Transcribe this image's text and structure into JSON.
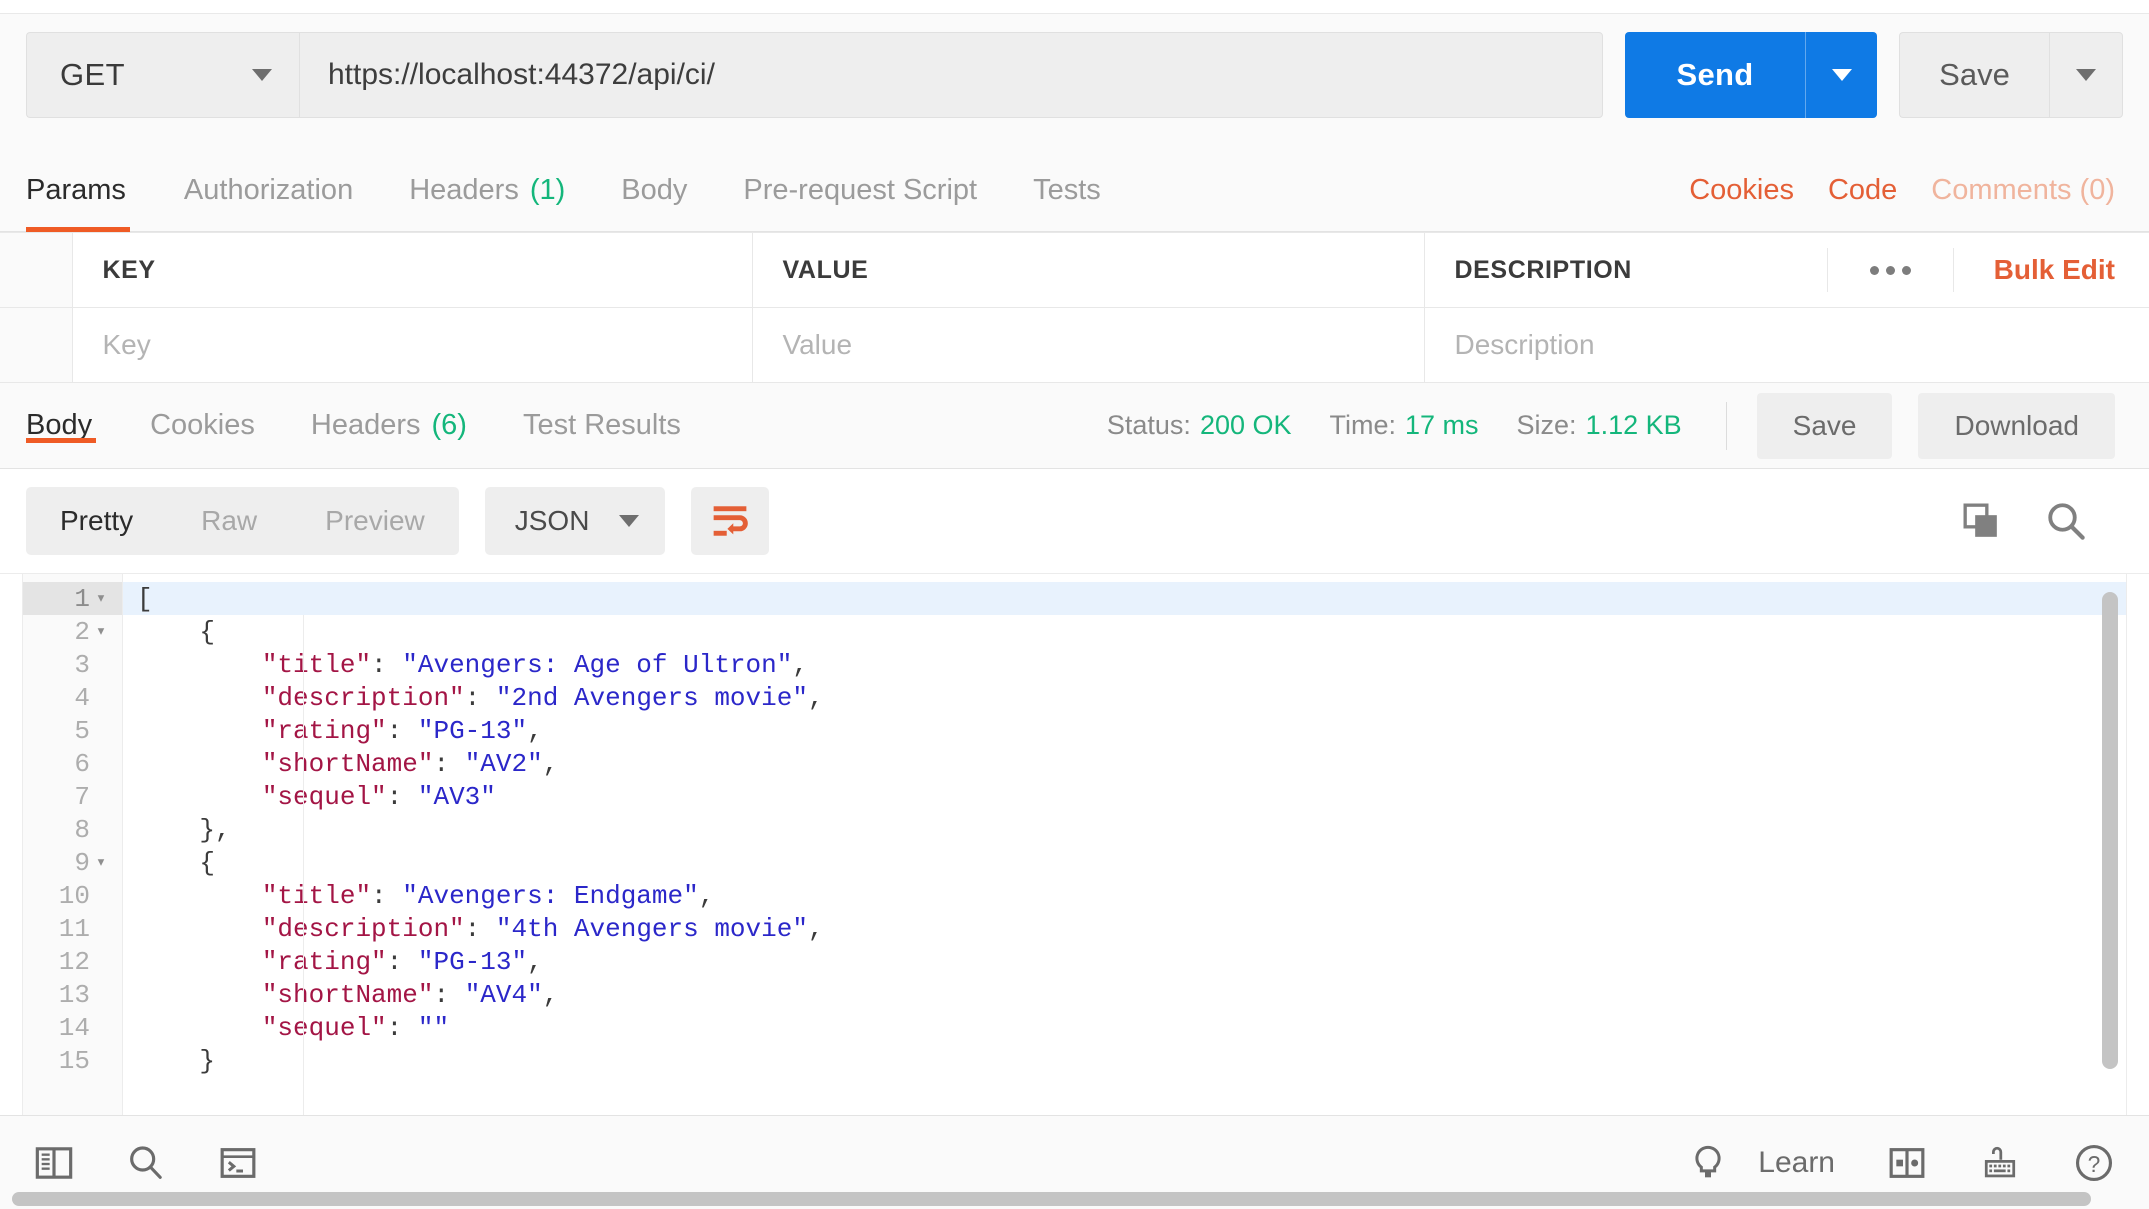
{
  "request": {
    "method": "GET",
    "url": "https://localhost:44372/api/ci/",
    "send_label": "Send",
    "save_label": "Save",
    "tabs": [
      {
        "label": "Params",
        "count": "",
        "active": true
      },
      {
        "label": "Authorization",
        "count": "",
        "active": false
      },
      {
        "label": "Headers",
        "count": "(1)",
        "active": false
      },
      {
        "label": "Body",
        "count": "",
        "active": false
      },
      {
        "label": "Pre-request Script",
        "count": "",
        "active": false
      },
      {
        "label": "Tests",
        "count": "",
        "active": false
      }
    ],
    "links": [
      {
        "label": "Cookies",
        "faded": false
      },
      {
        "label": "Code",
        "faded": false
      },
      {
        "label": "Comments (0)",
        "faded": true
      }
    ]
  },
  "params": {
    "headers": [
      "KEY",
      "VALUE",
      "DESCRIPTION"
    ],
    "bulk_edit_label": "Bulk Edit",
    "rows": [
      {
        "key_placeholder": "Key",
        "value_placeholder": "Value",
        "description_placeholder": "Description"
      }
    ]
  },
  "response": {
    "tabs": [
      {
        "label": "Body",
        "count": "",
        "active": true
      },
      {
        "label": "Cookies",
        "count": "",
        "active": false
      },
      {
        "label": "Headers",
        "count": "(6)",
        "active": false
      },
      {
        "label": "Test Results",
        "count": "",
        "active": false
      }
    ],
    "meta": [
      {
        "label": "Status:",
        "value": "200 OK"
      },
      {
        "label": "Time:",
        "value": "17 ms"
      },
      {
        "label": "Size:",
        "value": "1.12 KB"
      }
    ],
    "save_label": "Save",
    "download_label": "Download",
    "format": {
      "modes": [
        {
          "label": "Pretty",
          "active": true
        },
        {
          "label": "Raw",
          "active": false
        },
        {
          "label": "Preview",
          "active": false
        }
      ],
      "language": "JSON"
    },
    "body_lines": [
      {
        "n": "1",
        "fold": true,
        "highlight": true,
        "segments": [
          {
            "t": "[",
            "c": "p"
          }
        ]
      },
      {
        "n": "2",
        "fold": true,
        "highlight": false,
        "segments": [
          {
            "t": "    {",
            "c": "p"
          }
        ]
      },
      {
        "n": "3",
        "fold": false,
        "highlight": false,
        "segments": [
          {
            "t": "        ",
            "c": "p"
          },
          {
            "t": "\"title\"",
            "c": "k"
          },
          {
            "t": ": ",
            "c": "p"
          },
          {
            "t": "\"Avengers: Age of Ultron\"",
            "c": "v"
          },
          {
            "t": ",",
            "c": "p"
          }
        ]
      },
      {
        "n": "4",
        "fold": false,
        "highlight": false,
        "segments": [
          {
            "t": "        ",
            "c": "p"
          },
          {
            "t": "\"description\"",
            "c": "k"
          },
          {
            "t": ": ",
            "c": "p"
          },
          {
            "t": "\"2nd Avengers movie\"",
            "c": "v"
          },
          {
            "t": ",",
            "c": "p"
          }
        ]
      },
      {
        "n": "5",
        "fold": false,
        "highlight": false,
        "segments": [
          {
            "t": "        ",
            "c": "p"
          },
          {
            "t": "\"rating\"",
            "c": "k"
          },
          {
            "t": ": ",
            "c": "p"
          },
          {
            "t": "\"PG-13\"",
            "c": "v"
          },
          {
            "t": ",",
            "c": "p"
          }
        ]
      },
      {
        "n": "6",
        "fold": false,
        "highlight": false,
        "segments": [
          {
            "t": "        ",
            "c": "p"
          },
          {
            "t": "\"shortName\"",
            "c": "k"
          },
          {
            "t": ": ",
            "c": "p"
          },
          {
            "t": "\"AV2\"",
            "c": "v"
          },
          {
            "t": ",",
            "c": "p"
          }
        ]
      },
      {
        "n": "7",
        "fold": false,
        "highlight": false,
        "segments": [
          {
            "t": "        ",
            "c": "p"
          },
          {
            "t": "\"sequel\"",
            "c": "k"
          },
          {
            "t": ": ",
            "c": "p"
          },
          {
            "t": "\"AV3\"",
            "c": "v"
          }
        ]
      },
      {
        "n": "8",
        "fold": false,
        "highlight": false,
        "segments": [
          {
            "t": "    },",
            "c": "p"
          }
        ]
      },
      {
        "n": "9",
        "fold": true,
        "highlight": false,
        "segments": [
          {
            "t": "    {",
            "c": "p"
          }
        ]
      },
      {
        "n": "10",
        "fold": false,
        "highlight": false,
        "segments": [
          {
            "t": "        ",
            "c": "p"
          },
          {
            "t": "\"title\"",
            "c": "k"
          },
          {
            "t": ": ",
            "c": "p"
          },
          {
            "t": "\"Avengers: Endgame\"",
            "c": "v"
          },
          {
            "t": ",",
            "c": "p"
          }
        ]
      },
      {
        "n": "11",
        "fold": false,
        "highlight": false,
        "segments": [
          {
            "t": "        ",
            "c": "p"
          },
          {
            "t": "\"description\"",
            "c": "k"
          },
          {
            "t": ": ",
            "c": "p"
          },
          {
            "t": "\"4th Avengers movie\"",
            "c": "v"
          },
          {
            "t": ",",
            "c": "p"
          }
        ]
      },
      {
        "n": "12",
        "fold": false,
        "highlight": false,
        "segments": [
          {
            "t": "        ",
            "c": "p"
          },
          {
            "t": "\"rating\"",
            "c": "k"
          },
          {
            "t": ": ",
            "c": "p"
          },
          {
            "t": "\"PG-13\"",
            "c": "v"
          },
          {
            "t": ",",
            "c": "p"
          }
        ]
      },
      {
        "n": "13",
        "fold": false,
        "highlight": false,
        "segments": [
          {
            "t": "        ",
            "c": "p"
          },
          {
            "t": "\"shortName\"",
            "c": "k"
          },
          {
            "t": ": ",
            "c": "p"
          },
          {
            "t": "\"AV4\"",
            "c": "v"
          },
          {
            "t": ",",
            "c": "p"
          }
        ]
      },
      {
        "n": "14",
        "fold": false,
        "highlight": false,
        "segments": [
          {
            "t": "        ",
            "c": "p"
          },
          {
            "t": "\"sequel\"",
            "c": "k"
          },
          {
            "t": ": ",
            "c": "p"
          },
          {
            "t": "\"\"",
            "c": "v"
          }
        ]
      },
      {
        "n": "15",
        "fold": false,
        "highlight": false,
        "segments": [
          {
            "t": "    }",
            "c": "p"
          }
        ]
      }
    ]
  },
  "footer": {
    "learn_label": "Learn"
  },
  "colors": {
    "accent_orange": "#ef5b25",
    "link_orange": "#e45f36",
    "send_blue": "#0f7ae5",
    "status_green": "#14b67b",
    "json_key": "#a31545",
    "json_value": "#2b27c9"
  }
}
